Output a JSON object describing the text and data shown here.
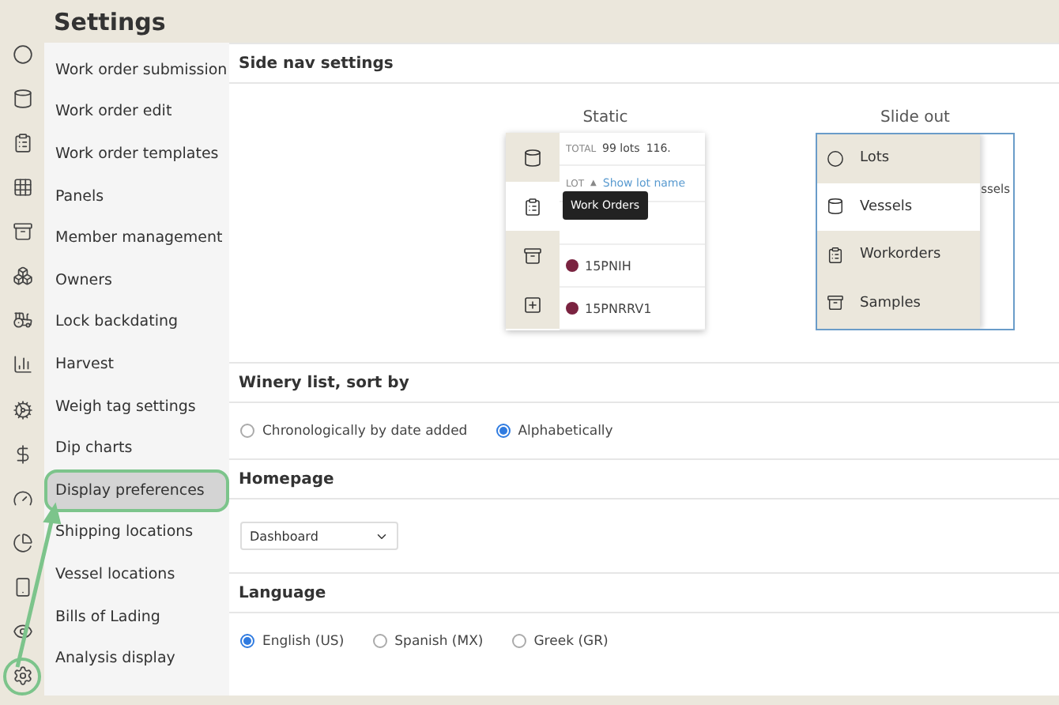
{
  "header": {
    "title": "Settings"
  },
  "rail": [
    {
      "kind": "circle",
      "selected": false
    },
    {
      "kind": "vessel",
      "selected": false
    },
    {
      "kind": "clipboard",
      "selected": false
    },
    {
      "kind": "grid",
      "selected": false
    },
    {
      "kind": "archive",
      "selected": false
    },
    {
      "kind": "boxes",
      "selected": false
    },
    {
      "kind": "tractor",
      "selected": false
    },
    {
      "kind": "chart",
      "selected": false
    },
    {
      "kind": "cogs",
      "selected": false
    },
    {
      "kind": "dollar",
      "selected": false
    },
    {
      "kind": "gauge",
      "selected": false
    },
    {
      "kind": "pie",
      "selected": false
    },
    {
      "kind": "phone",
      "selected": false
    },
    {
      "kind": "eye",
      "selected": false
    },
    {
      "kind": "gear",
      "selected": true
    }
  ],
  "submenu": [
    {
      "label": "Work order submission",
      "selected": false
    },
    {
      "label": "Work order edit",
      "selected": false
    },
    {
      "label": "Work order templates",
      "selected": false
    },
    {
      "label": "Panels",
      "selected": false
    },
    {
      "label": "Member management",
      "selected": false
    },
    {
      "label": "Owners",
      "selected": false
    },
    {
      "label": "Lock backdating",
      "selected": false
    },
    {
      "label": "Harvest",
      "selected": false
    },
    {
      "label": "Weigh tag settings",
      "selected": false
    },
    {
      "label": "Dip charts",
      "selected": false
    },
    {
      "label": "Display preferences",
      "selected": true
    },
    {
      "label": "Shipping locations",
      "selected": false
    },
    {
      "label": "Vessel locations",
      "selected": false
    },
    {
      "label": "Bills of Lading",
      "selected": false
    },
    {
      "label": "Analysis display",
      "selected": false
    }
  ],
  "side_nav": {
    "title": "Side nav settings",
    "static": {
      "caption": "Static",
      "total_label": "TOTAL",
      "total_value": "99 lots",
      "total_extra": "116.",
      "sort_label": "LOT",
      "sort_icon": "▲",
      "link": "Show lot name",
      "tooltip": "Work Orders",
      "icons": [
        {
          "kind": "vessel",
          "selected": false
        },
        {
          "kind": "clipboard",
          "selected": true
        },
        {
          "kind": "archive",
          "selected": false
        },
        {
          "kind": "plus",
          "selected": false
        }
      ],
      "lots": [
        {
          "name": "15PNIH",
          "color": "#7a2340"
        },
        {
          "name": "15PNRRV1",
          "color": "#7a2340"
        }
      ]
    },
    "slide_out": {
      "caption": "Slide out",
      "behind_text": "ssels",
      "items": [
        {
          "kind": "circle",
          "label": "Lots",
          "selected": false
        },
        {
          "kind": "vessel",
          "label": "Vessels",
          "selected": true
        },
        {
          "kind": "clipboard",
          "label": "Workorders",
          "selected": false
        },
        {
          "kind": "archive",
          "label": "Samples",
          "selected": false
        }
      ]
    }
  },
  "winery_sort": {
    "title": "Winery list, sort by",
    "options": [
      {
        "label": "Chronologically by date added",
        "selected": false
      },
      {
        "label": "Alphabetically",
        "selected": true
      }
    ]
  },
  "homepage": {
    "title": "Homepage",
    "value": "Dashboard"
  },
  "language": {
    "title": "Language",
    "options": [
      {
        "label": "English (US)",
        "selected": true
      },
      {
        "label": "Spanish (MX)",
        "selected": false
      },
      {
        "label": "Greek (GR)",
        "selected": false
      }
    ]
  }
}
